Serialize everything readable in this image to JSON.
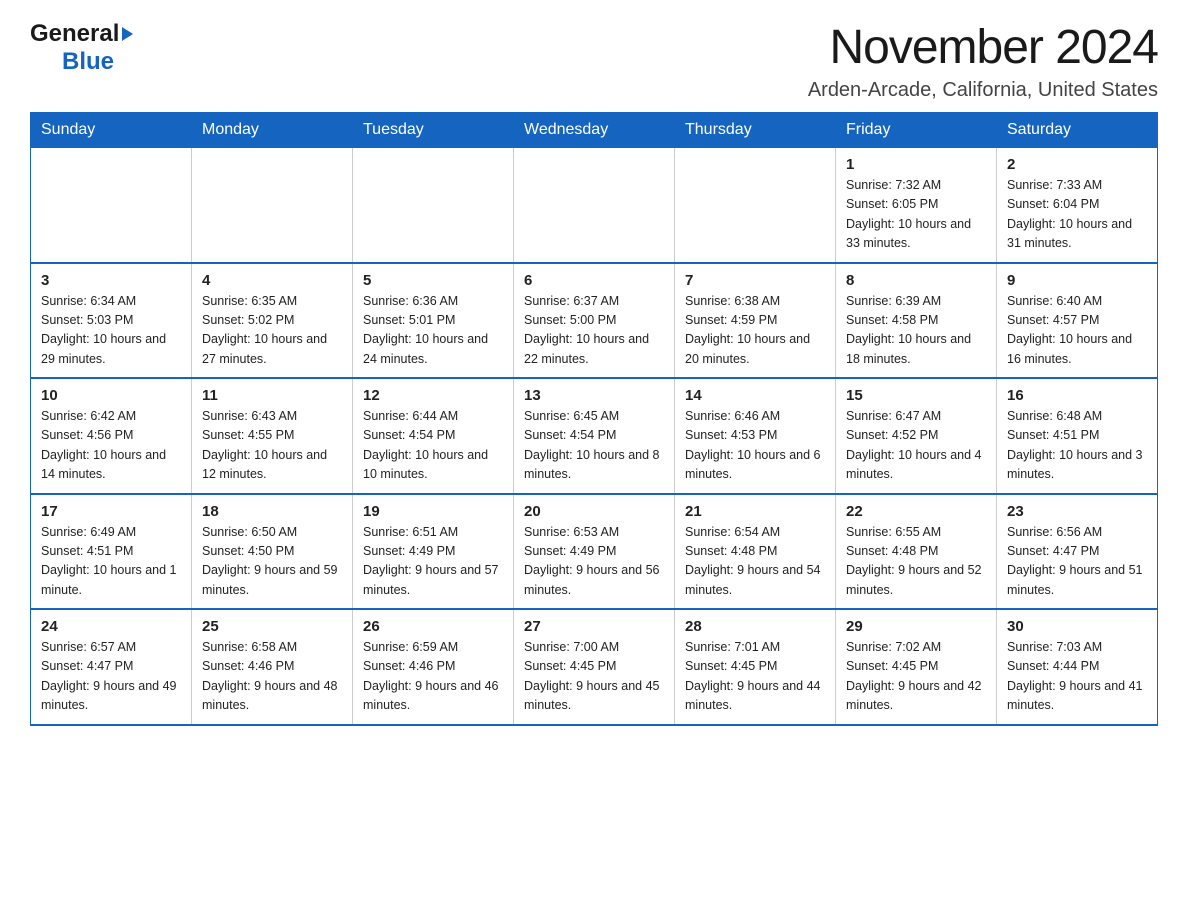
{
  "header": {
    "logo_general": "General",
    "logo_blue": "Blue",
    "month_title": "November 2024",
    "location": "Arden-Arcade, California, United States"
  },
  "days_of_week": [
    "Sunday",
    "Monday",
    "Tuesday",
    "Wednesday",
    "Thursday",
    "Friday",
    "Saturday"
  ],
  "weeks": [
    [
      {
        "day": "",
        "info": ""
      },
      {
        "day": "",
        "info": ""
      },
      {
        "day": "",
        "info": ""
      },
      {
        "day": "",
        "info": ""
      },
      {
        "day": "",
        "info": ""
      },
      {
        "day": "1",
        "info": "Sunrise: 7:32 AM\nSunset: 6:05 PM\nDaylight: 10 hours and 33 minutes."
      },
      {
        "day": "2",
        "info": "Sunrise: 7:33 AM\nSunset: 6:04 PM\nDaylight: 10 hours and 31 minutes."
      }
    ],
    [
      {
        "day": "3",
        "info": "Sunrise: 6:34 AM\nSunset: 5:03 PM\nDaylight: 10 hours and 29 minutes."
      },
      {
        "day": "4",
        "info": "Sunrise: 6:35 AM\nSunset: 5:02 PM\nDaylight: 10 hours and 27 minutes."
      },
      {
        "day": "5",
        "info": "Sunrise: 6:36 AM\nSunset: 5:01 PM\nDaylight: 10 hours and 24 minutes."
      },
      {
        "day": "6",
        "info": "Sunrise: 6:37 AM\nSunset: 5:00 PM\nDaylight: 10 hours and 22 minutes."
      },
      {
        "day": "7",
        "info": "Sunrise: 6:38 AM\nSunset: 4:59 PM\nDaylight: 10 hours and 20 minutes."
      },
      {
        "day": "8",
        "info": "Sunrise: 6:39 AM\nSunset: 4:58 PM\nDaylight: 10 hours and 18 minutes."
      },
      {
        "day": "9",
        "info": "Sunrise: 6:40 AM\nSunset: 4:57 PM\nDaylight: 10 hours and 16 minutes."
      }
    ],
    [
      {
        "day": "10",
        "info": "Sunrise: 6:42 AM\nSunset: 4:56 PM\nDaylight: 10 hours and 14 minutes."
      },
      {
        "day": "11",
        "info": "Sunrise: 6:43 AM\nSunset: 4:55 PM\nDaylight: 10 hours and 12 minutes."
      },
      {
        "day": "12",
        "info": "Sunrise: 6:44 AM\nSunset: 4:54 PM\nDaylight: 10 hours and 10 minutes."
      },
      {
        "day": "13",
        "info": "Sunrise: 6:45 AM\nSunset: 4:54 PM\nDaylight: 10 hours and 8 minutes."
      },
      {
        "day": "14",
        "info": "Sunrise: 6:46 AM\nSunset: 4:53 PM\nDaylight: 10 hours and 6 minutes."
      },
      {
        "day": "15",
        "info": "Sunrise: 6:47 AM\nSunset: 4:52 PM\nDaylight: 10 hours and 4 minutes."
      },
      {
        "day": "16",
        "info": "Sunrise: 6:48 AM\nSunset: 4:51 PM\nDaylight: 10 hours and 3 minutes."
      }
    ],
    [
      {
        "day": "17",
        "info": "Sunrise: 6:49 AM\nSunset: 4:51 PM\nDaylight: 10 hours and 1 minute."
      },
      {
        "day": "18",
        "info": "Sunrise: 6:50 AM\nSunset: 4:50 PM\nDaylight: 9 hours and 59 minutes."
      },
      {
        "day": "19",
        "info": "Sunrise: 6:51 AM\nSunset: 4:49 PM\nDaylight: 9 hours and 57 minutes."
      },
      {
        "day": "20",
        "info": "Sunrise: 6:53 AM\nSunset: 4:49 PM\nDaylight: 9 hours and 56 minutes."
      },
      {
        "day": "21",
        "info": "Sunrise: 6:54 AM\nSunset: 4:48 PM\nDaylight: 9 hours and 54 minutes."
      },
      {
        "day": "22",
        "info": "Sunrise: 6:55 AM\nSunset: 4:48 PM\nDaylight: 9 hours and 52 minutes."
      },
      {
        "day": "23",
        "info": "Sunrise: 6:56 AM\nSunset: 4:47 PM\nDaylight: 9 hours and 51 minutes."
      }
    ],
    [
      {
        "day": "24",
        "info": "Sunrise: 6:57 AM\nSunset: 4:47 PM\nDaylight: 9 hours and 49 minutes."
      },
      {
        "day": "25",
        "info": "Sunrise: 6:58 AM\nSunset: 4:46 PM\nDaylight: 9 hours and 48 minutes."
      },
      {
        "day": "26",
        "info": "Sunrise: 6:59 AM\nSunset: 4:46 PM\nDaylight: 9 hours and 46 minutes."
      },
      {
        "day": "27",
        "info": "Sunrise: 7:00 AM\nSunset: 4:45 PM\nDaylight: 9 hours and 45 minutes."
      },
      {
        "day": "28",
        "info": "Sunrise: 7:01 AM\nSunset: 4:45 PM\nDaylight: 9 hours and 44 minutes."
      },
      {
        "day": "29",
        "info": "Sunrise: 7:02 AM\nSunset: 4:45 PM\nDaylight: 9 hours and 42 minutes."
      },
      {
        "day": "30",
        "info": "Sunrise: 7:03 AM\nSunset: 4:44 PM\nDaylight: 9 hours and 41 minutes."
      }
    ]
  ]
}
